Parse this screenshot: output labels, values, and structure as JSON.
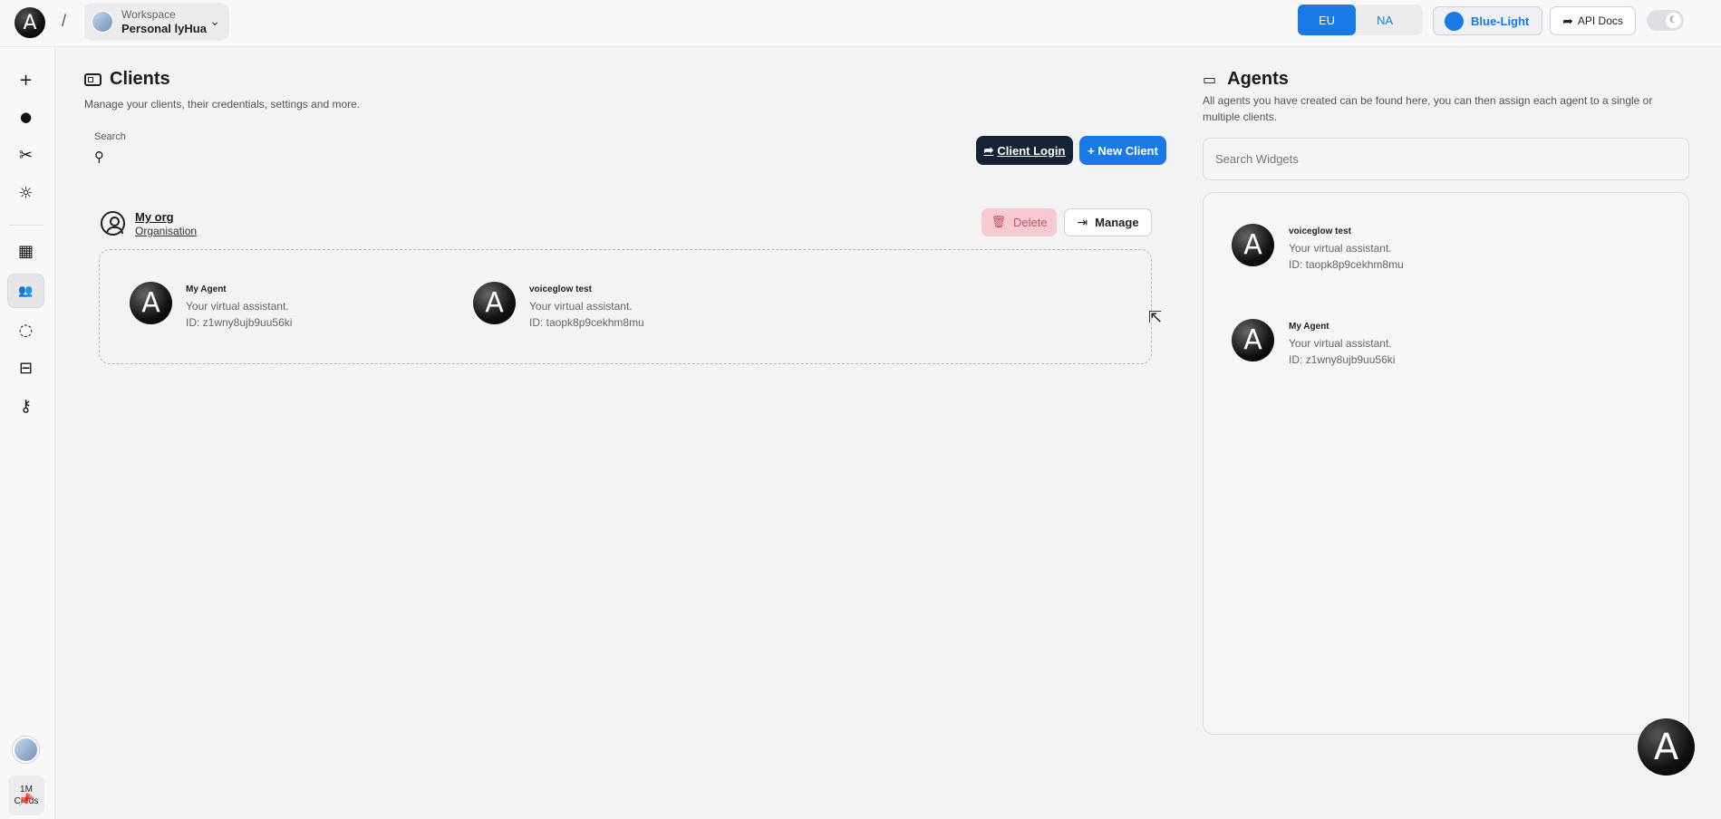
{
  "brand": {
    "logo_letter": "A"
  },
  "breadcrumb": {
    "separator": "/"
  },
  "workspace": {
    "label": "Workspace",
    "name": "Personal lyHua"
  },
  "region": {
    "options": [
      "EU",
      "NA"
    ],
    "selected": "EU"
  },
  "theme": {
    "label": "Blue-Light",
    "accent": "#1979e6"
  },
  "header": {
    "api_docs_label": "API Docs"
  },
  "sidebar": {
    "items": [
      {
        "icon": "plus-icon",
        "glyph": "+"
      },
      {
        "icon": "agent-icon",
        "glyph": "●"
      },
      {
        "icon": "tools-icon",
        "glyph": "✂"
      },
      {
        "icon": "bug-icon",
        "glyph": "☼"
      },
      {
        "icon": "building-icon",
        "glyph": "▦"
      },
      {
        "icon": "users-icon",
        "glyph": "👥",
        "active": true
      },
      {
        "icon": "loader-icon",
        "glyph": "◌"
      },
      {
        "icon": "database-icon",
        "glyph": "⊟"
      },
      {
        "icon": "key-icon",
        "glyph": "⚷"
      }
    ],
    "creds": {
      "amount": "1M",
      "label": "Creds"
    },
    "pin_glyph": "📌"
  },
  "clients": {
    "title": "Clients",
    "subtitle": "Manage your clients, their credentials, settings and more.",
    "search_label": "Search",
    "client_login_label": "Client Login",
    "new_client_label": "+ New Client",
    "org": {
      "name": "My org",
      "type": "Organisation",
      "delete_label": "Delete",
      "manage_label": "Manage",
      "agents": [
        {
          "name": "My Agent",
          "description": "Your virtual assistant.",
          "id": "ID: z1wny8ujb9uu56ki"
        },
        {
          "name": "voiceglow test",
          "description": "Your virtual assistant.",
          "id": "ID: taopk8p9cekhm8mu"
        }
      ]
    }
  },
  "agents_panel": {
    "title": "Agents",
    "subtitle": "All agents you have created can be found here, you can then assign each agent to a single or multiple clients.",
    "search_placeholder": "Search Widgets",
    "agents": [
      {
        "name": "voiceglow test",
        "description": "Your virtual assistant.",
        "id": "ID: taopk8p9cekhm8mu"
      },
      {
        "name": "My Agent",
        "description": "Your virtual assistant.",
        "id": "ID: z1wny8ujb9uu56ki"
      }
    ]
  }
}
